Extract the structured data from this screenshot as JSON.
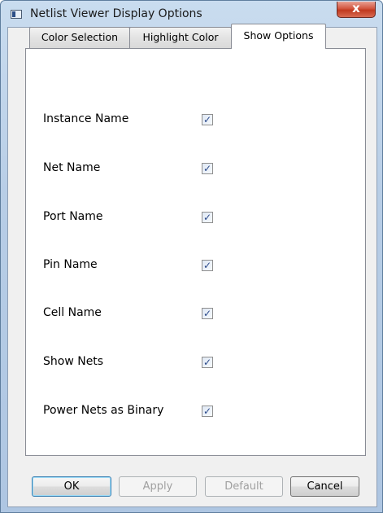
{
  "window": {
    "title": "Netlist Viewer Display Options",
    "close_glyph": "x"
  },
  "tabs": [
    {
      "label": "Color Selection",
      "active": false
    },
    {
      "label": "Highlight Color",
      "active": false
    },
    {
      "label": "Show Options",
      "active": true
    }
  ],
  "options": [
    {
      "label": "Instance Name",
      "checked": true
    },
    {
      "label": "Net Name",
      "checked": true
    },
    {
      "label": "Port Name",
      "checked": true
    },
    {
      "label": "Pin Name",
      "checked": true
    },
    {
      "label": "Cell Name",
      "checked": true
    },
    {
      "label": "Show Nets",
      "checked": true
    },
    {
      "label": "Power Nets as Binary",
      "checked": true
    }
  ],
  "check_glyph": "✓",
  "buttons": {
    "ok": "OK",
    "apply": "Apply",
    "default": "Default",
    "cancel": "Cancel"
  },
  "colors": {
    "title_bar": "#b7cde6",
    "close_button": "#c0391f",
    "check_mark": "#2b4a8b"
  }
}
